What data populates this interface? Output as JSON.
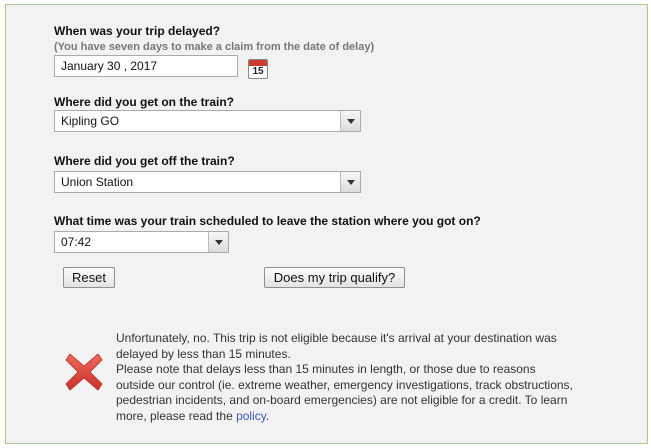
{
  "form": {
    "date_question": "When was your trip delayed?",
    "date_note": "(You have seven days to make a claim from the date of delay)",
    "date_value": "January 30 , 2017",
    "calendar_day": "15",
    "origin_question": "Where did you get on the train?",
    "origin_value": "Kipling GO",
    "destination_question": "Where did you get off the train?",
    "destination_value": "Union Station",
    "time_question": "What time was your train scheduled to leave the station where you got on?",
    "time_value": "07:42",
    "reset_label": "Reset",
    "qualify_label": "Does my trip qualify?"
  },
  "result": {
    "line1": "Unfortunately, no. This trip is not eligible because it's arrival at your destination was delayed by less than 15 minutes.",
    "line2": "Please note that delays less than 15 minutes in length, or those due to reasons outside our control (ie. extreme weather, emergency investigations, track obstructions, pedestrian incidents, and on-board emergencies) are not eligible for a credit. To learn more, please read the ",
    "policy_link": "policy",
    "period": "."
  },
  "colors": {
    "panel_border": "#a9c98a",
    "link": "#3a57b8",
    "error_x": "#e2463b"
  },
  "icons": {
    "calendar": "calendar-icon",
    "dropdown": "chevron-down-icon",
    "result": "error-x-icon"
  }
}
